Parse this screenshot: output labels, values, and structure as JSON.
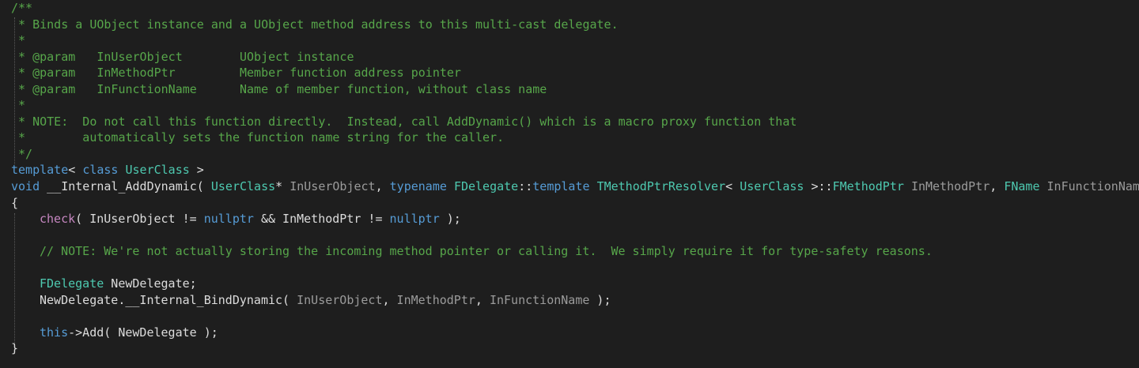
{
  "code": {
    "language": "cpp",
    "lines": [
      {
        "tokens": [
          {
            "cls": "c",
            "text": "/**"
          }
        ]
      },
      {
        "tokens": [
          {
            "cls": "c",
            "text": " * Binds a UObject instance and a UObject method address to this multi-cast delegate."
          }
        ]
      },
      {
        "tokens": [
          {
            "cls": "c",
            "text": " *"
          }
        ]
      },
      {
        "tokens": [
          {
            "cls": "c",
            "text": " * @param   InUserObject        UObject instance"
          }
        ]
      },
      {
        "tokens": [
          {
            "cls": "c",
            "text": " * @param   InMethodPtr         Member function address pointer"
          }
        ]
      },
      {
        "tokens": [
          {
            "cls": "c",
            "text": " * @param   InFunctionName      Name of member function, without class name"
          }
        ]
      },
      {
        "tokens": [
          {
            "cls": "c",
            "text": " *"
          }
        ]
      },
      {
        "tokens": [
          {
            "cls": "c",
            "text": " * NOTE:  Do not call this function directly.  Instead, call AddDynamic() which is a macro proxy function that"
          }
        ]
      },
      {
        "tokens": [
          {
            "cls": "c",
            "text": " *        automatically sets the function name string for the caller."
          }
        ]
      },
      {
        "tokens": [
          {
            "cls": "c",
            "text": " */"
          }
        ]
      },
      {
        "tokens": [
          {
            "cls": "k",
            "text": "template"
          },
          {
            "cls": "pl",
            "text": "< "
          },
          {
            "cls": "k",
            "text": "class"
          },
          {
            "cls": "pl",
            "text": " "
          },
          {
            "cls": "t",
            "text": "UserClass"
          },
          {
            "cls": "pl",
            "text": " >"
          }
        ]
      },
      {
        "tokens": [
          {
            "cls": "k",
            "text": "void"
          },
          {
            "cls": "pl",
            "text": " __Internal_AddDynamic( "
          },
          {
            "cls": "t",
            "text": "UserClass"
          },
          {
            "cls": "pl",
            "text": "* "
          },
          {
            "cls": "pa",
            "text": "InUserObject"
          },
          {
            "cls": "pl",
            "text": ", "
          },
          {
            "cls": "k",
            "text": "typename"
          },
          {
            "cls": "pl",
            "text": " "
          },
          {
            "cls": "t",
            "text": "FDelegate"
          },
          {
            "cls": "pl",
            "text": "::"
          },
          {
            "cls": "k",
            "text": "template"
          },
          {
            "cls": "pl",
            "text": " "
          },
          {
            "cls": "t",
            "text": "TMethodPtrResolver"
          },
          {
            "cls": "pl",
            "text": "< "
          },
          {
            "cls": "t",
            "text": "UserClass"
          },
          {
            "cls": "pl",
            "text": " >::"
          },
          {
            "cls": "t",
            "text": "FMethodPtr"
          },
          {
            "cls": "pl",
            "text": " "
          },
          {
            "cls": "pa",
            "text": "InMethodPtr"
          },
          {
            "cls": "pl",
            "text": ", "
          },
          {
            "cls": "t",
            "text": "FName"
          },
          {
            "cls": "pl",
            "text": " "
          },
          {
            "cls": "pa",
            "text": "InFunctionName"
          }
        ]
      },
      {
        "tokens": [
          {
            "cls": "pl",
            "text": "{"
          }
        ]
      },
      {
        "indent": true,
        "tokens": [
          {
            "cls": "m",
            "text": "check"
          },
          {
            "cls": "pl",
            "text": "( InUserObject != "
          },
          {
            "cls": "k",
            "text": "nullptr"
          },
          {
            "cls": "pl",
            "text": " && InMethodPtr != "
          },
          {
            "cls": "k",
            "text": "nullptr"
          },
          {
            "cls": "pl",
            "text": " );"
          }
        ]
      },
      {
        "indent": true,
        "tokens": []
      },
      {
        "indent": true,
        "tokens": [
          {
            "cls": "c",
            "text": "// NOTE: We're not actually storing the incoming method pointer or calling it.  We simply require it for type-safety reasons."
          }
        ]
      },
      {
        "indent": true,
        "tokens": []
      },
      {
        "indent": true,
        "tokens": [
          {
            "cls": "t",
            "text": "FDelegate"
          },
          {
            "cls": "pl",
            "text": " NewDelegate;"
          }
        ]
      },
      {
        "indent": true,
        "tokens": [
          {
            "cls": "pl",
            "text": "NewDelegate.__Internal_BindDynamic( "
          },
          {
            "cls": "pa",
            "text": "InUserObject"
          },
          {
            "cls": "pl",
            "text": ", "
          },
          {
            "cls": "pa",
            "text": "InMethodPtr"
          },
          {
            "cls": "pl",
            "text": ", "
          },
          {
            "cls": "pa",
            "text": "InFunctionName"
          },
          {
            "cls": "pl",
            "text": " );"
          }
        ]
      },
      {
        "indent": true,
        "tokens": []
      },
      {
        "indent": true,
        "tokens": [
          {
            "cls": "k",
            "text": "this"
          },
          {
            "cls": "pl",
            "text": "->Add( NewDelegate );"
          }
        ]
      },
      {
        "tokens": [
          {
            "cls": "pl",
            "text": "}"
          }
        ]
      }
    ]
  },
  "colors": {
    "background": "#1e1e1e",
    "comment": "#57a64a",
    "keyword": "#569cd6",
    "type": "#4ec9b0",
    "parameter": "#9b9b9b",
    "macro": "#c586c0",
    "plain": "#dcdcdc"
  }
}
